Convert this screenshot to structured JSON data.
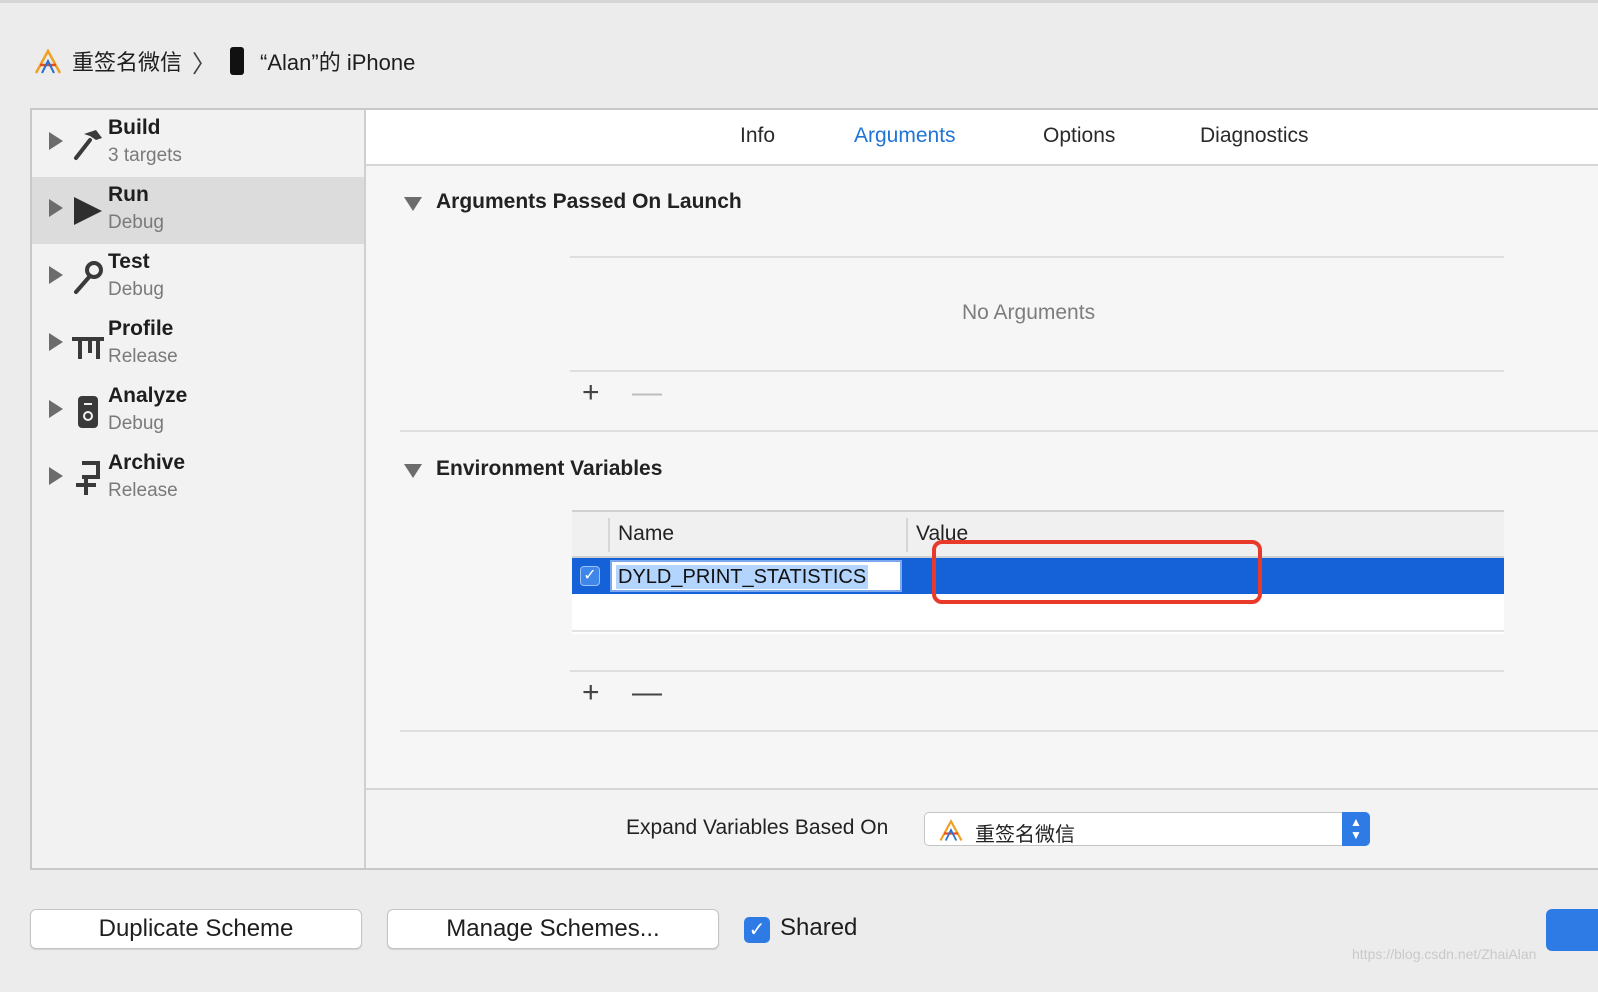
{
  "breadcrumb": {
    "app_name": "重签名微信",
    "separator": "〉",
    "device_name": "“Alan”的 iPhone"
  },
  "sidebar": {
    "items": [
      {
        "title": "Build",
        "subtitle": "3 targets",
        "icon": "hammer-icon"
      },
      {
        "title": "Run",
        "subtitle": "Debug",
        "icon": "play-icon",
        "selected": true
      },
      {
        "title": "Test",
        "subtitle": "Debug",
        "icon": "wrench-icon"
      },
      {
        "title": "Profile",
        "subtitle": "Release",
        "icon": "instruments-icon"
      },
      {
        "title": "Analyze",
        "subtitle": "Debug",
        "icon": "analyze-icon"
      },
      {
        "title": "Archive",
        "subtitle": "Release",
        "icon": "archive-icon"
      }
    ]
  },
  "tabs": [
    {
      "label": "Info"
    },
    {
      "label": "Arguments",
      "active": true
    },
    {
      "label": "Options"
    },
    {
      "label": "Diagnostics"
    }
  ],
  "arguments_section": {
    "title": "Arguments Passed On Launch",
    "empty_text": "No Arguments",
    "add_label": "+",
    "remove_label": "—"
  },
  "env_section": {
    "title": "Environment Variables",
    "columns": {
      "name": "Name",
      "value": "Value"
    },
    "rows": [
      {
        "enabled": true,
        "name": "DYLD_PRINT_STATISTICS",
        "value": ""
      }
    ],
    "add_label": "+",
    "remove_label": "—"
  },
  "expand": {
    "label": "Expand Variables Based On",
    "selected": "重签名微信"
  },
  "footer": {
    "duplicate_label": "Duplicate Scheme",
    "manage_label": "Manage Schemes...",
    "shared_label": "Shared",
    "shared_checked": true,
    "check_glyph": "✓"
  },
  "watermark": "https://blog.csdn.net/ZhaiAlan",
  "colors": {
    "accent": "#1f74d6",
    "selection": "#1561d8",
    "highlight_box": "#e9392a"
  }
}
